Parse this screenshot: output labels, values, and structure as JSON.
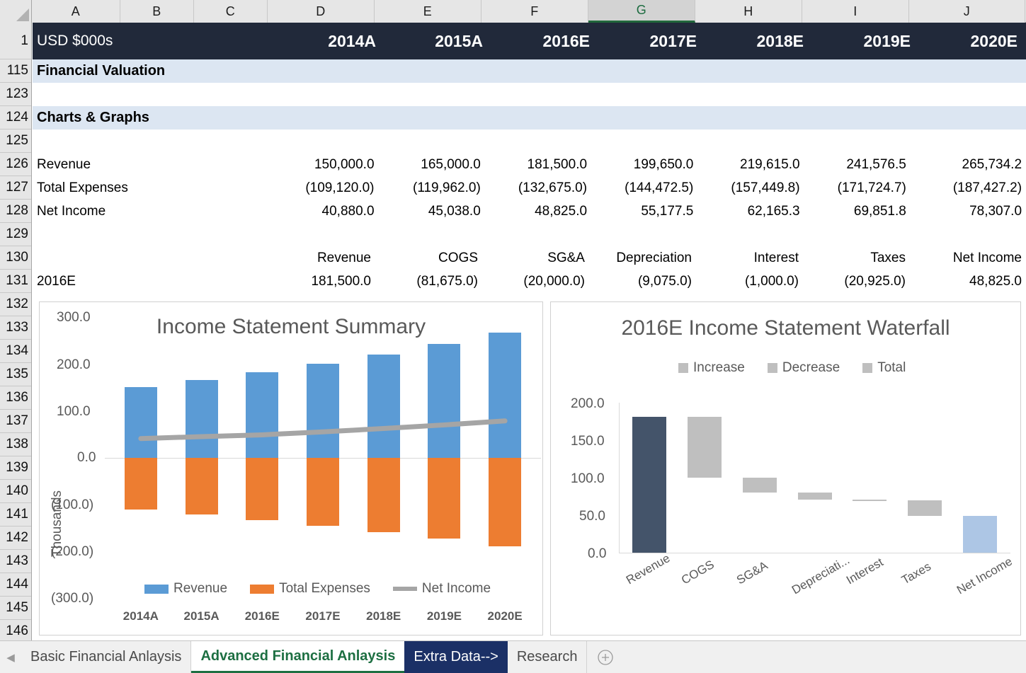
{
  "grid": {
    "columns": [
      "A",
      "B",
      "C",
      "D",
      "E",
      "F",
      "G",
      "H",
      "I",
      "J"
    ],
    "selected_column": "G",
    "row_numbers": [
      "1",
      "115",
      "123",
      "124",
      "125",
      "126",
      "127",
      "128",
      "129",
      "130",
      "131",
      "132",
      "133",
      "134",
      "135",
      "136",
      "137",
      "138",
      "139",
      "140",
      "141",
      "142",
      "143",
      "144",
      "145",
      "146"
    ]
  },
  "header": {
    "unit_label": "USD $000s",
    "years": [
      "2014A",
      "2015A",
      "2016E",
      "2017E",
      "2018E",
      "2019E",
      "2020E"
    ]
  },
  "sections": {
    "financial_valuation": "Financial Valuation",
    "charts_graphs": "Charts & Graphs"
  },
  "income_statement": {
    "rows": [
      {
        "label": "Revenue",
        "values": [
          "150,000.0",
          "165,000.0",
          "181,500.0",
          "199,650.0",
          "219,615.0",
          "241,576.5",
          "265,734.2"
        ]
      },
      {
        "label": "Total Expenses",
        "values": [
          "(109,120.0)",
          "(119,962.0)",
          "(132,675.0)",
          "(144,472.5)",
          "(157,449.8)",
          "(171,724.7)",
          "(187,427.2)"
        ]
      },
      {
        "label": "Net Income",
        "values": [
          "40,880.0",
          "45,038.0",
          "48,825.0",
          "55,177.5",
          "62,165.3",
          "69,851.8",
          "78,307.0"
        ]
      }
    ]
  },
  "waterfall_table": {
    "headers": [
      "Revenue",
      "COGS",
      "SG&A",
      "Depreciation",
      "Interest",
      "Taxes",
      "Net Income"
    ],
    "row_label": "2016E",
    "values": [
      "181,500.0",
      "(81,675.0)",
      "(20,000.0)",
      "(9,075.0)",
      "(1,000.0)",
      "(20,925.0)",
      "48,825.0"
    ]
  },
  "chart_data": [
    {
      "id": "income-statement-summary",
      "type": "bar",
      "title": "Income Statement Summary",
      "categories": [
        "2014A",
        "2015A",
        "2016E",
        "2017E",
        "2018E",
        "2019E",
        "2020E"
      ],
      "series": [
        {
          "name": "Revenue",
          "kind": "bar",
          "color": "#5B9BD5",
          "values": [
            150.0,
            165.0,
            181.5,
            199.65,
            219.615,
            241.5765,
            265.7342
          ]
        },
        {
          "name": "Total Expenses",
          "kind": "bar",
          "color": "#ED7D31",
          "values": [
            -109.12,
            -119.962,
            -132.675,
            -144.4725,
            -157.4498,
            -171.7247,
            -187.4272
          ]
        },
        {
          "name": "Net Income",
          "kind": "line",
          "color": "#A5A5A5",
          "values": [
            40.88,
            45.038,
            48.825,
            55.1775,
            62.1653,
            69.8518,
            78.307
          ]
        }
      ],
      "ylabel": "Thousands",
      "xlabel": "",
      "ylim": [
        -300,
        300
      ],
      "yticks": [
        "300.0",
        "200.0",
        "100.0",
        "0.0",
        "(100.0)",
        "(200.0)",
        "(300.0)"
      ],
      "legend_position": "bottom",
      "grid": false
    },
    {
      "id": "income-statement-waterfall",
      "type": "bar",
      "title": "2016E Income Statement Waterfall",
      "categories": [
        "Revenue",
        "COGS",
        "SG&A",
        "Depreciati...",
        "Interest",
        "Taxes",
        "Net Income"
      ],
      "legend": [
        "Increase",
        "Decrease",
        "Total"
      ],
      "legend_position": "top",
      "bars": [
        {
          "label": "Revenue",
          "base": 0.0,
          "top": 181.5,
          "color": "#44546A",
          "role": "total"
        },
        {
          "label": "COGS",
          "base": 99.825,
          "top": 181.5,
          "color": "#BFBFBF",
          "role": "decrease"
        },
        {
          "label": "SG&A",
          "base": 79.825,
          "top": 99.825,
          "color": "#BFBFBF",
          "role": "decrease"
        },
        {
          "label": "Depreciati...",
          "base": 70.75,
          "top": 79.825,
          "color": "#BFBFBF",
          "role": "decrease"
        },
        {
          "label": "Interest",
          "base": 69.75,
          "top": 70.75,
          "color": "#BFBFBF",
          "role": "decrease"
        },
        {
          "label": "Taxes",
          "base": 48.825,
          "top": 69.75,
          "color": "#BFBFBF",
          "role": "decrease"
        },
        {
          "label": "Net Income",
          "base": 0.0,
          "top": 48.825,
          "color": "#ADC6E5",
          "role": "total"
        }
      ],
      "ylim": [
        0,
        200
      ],
      "yticks": [
        "200.0",
        "150.0",
        "100.0",
        "50.0",
        "0.0"
      ],
      "ylabel": "",
      "xlabel": "",
      "grid": false
    }
  ],
  "tabs": [
    {
      "label": "Basic Financial Anlaysis",
      "state": "normal"
    },
    {
      "label": "Advanced Financial Anlaysis",
      "state": "active"
    },
    {
      "label": "Extra Data-->",
      "state": "navy"
    },
    {
      "label": "Research",
      "state": "normal"
    }
  ],
  "tab_add_icon": "+"
}
